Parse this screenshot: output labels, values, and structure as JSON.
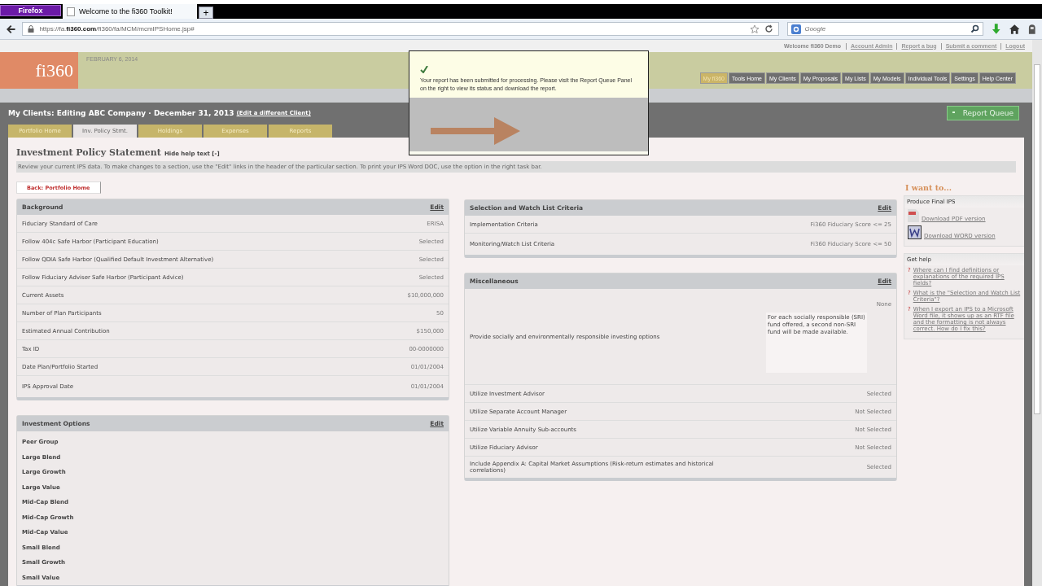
{
  "browser": {
    "firefox_button": "Firefox",
    "tab_title": "Welcome to the fi360 Toolkit!",
    "new_tab": "+",
    "url": "https://fa.**fi360.com**/fi360/fa/MCM/mcmIPSHome.jsp#",
    "search_placeholder": "Google"
  },
  "top_links": {
    "welcome": "Welcome fi360 Demo",
    "links": [
      "Account Admin",
      "Report a bug",
      "Submit a comment",
      "Logout"
    ]
  },
  "header": {
    "logo": "fi360",
    "date": "FEBRUARY 6, 2014",
    "menu": [
      {
        "label": "My fi360",
        "selected": true
      },
      {
        "label": "Tools Home",
        "selected": false
      },
      {
        "label": "My Clients",
        "selected": false
      },
      {
        "label": "My Proposals",
        "selected": false
      },
      {
        "label": "My Lists",
        "selected": false
      },
      {
        "label": "My Models",
        "selected": false
      },
      {
        "label": "Individual Tools",
        "selected": false
      },
      {
        "label": "Settings",
        "selected": false
      },
      {
        "label": "Help Center",
        "selected": false
      }
    ]
  },
  "client_bar": {
    "title": "My Clients: Editing ABC Company · December 31, 2013",
    "link": "(Edit a different Client)",
    "report_queue": "Report Queue"
  },
  "tabs": [
    {
      "label": "Portfolio Home",
      "selected": false
    },
    {
      "label": "Inv. Policy Stmt.",
      "selected": true
    },
    {
      "label": "Holdings",
      "selected": false
    },
    {
      "label": "Expenses",
      "selected": false
    },
    {
      "label": "Reports",
      "selected": false
    }
  ],
  "popup": {
    "message": "Your report has been submitted for processing. Please visit the Report Queue Panel on the right to view its status and download the report."
  },
  "page": {
    "title": "Investment Policy Statement",
    "help_toggle": "Hide help text [-]",
    "help_text": "Review your current IPS data. To make changes to a section, use the \"Edit\" links in the header of the particular section. To print your IPS Word DOC, use the option in the right task bar.",
    "back_button": "Back: Portfolio Home"
  },
  "sections_left": [
    {
      "title": "Background",
      "edit": "Edit",
      "kind": "table",
      "rows": [
        {
          "label": "Fiduciary Standard of Care",
          "value": "ERISA"
        },
        {
          "label": "Follow 404c Safe Harbor (Participant Education)",
          "value": "Selected"
        },
        {
          "label": "Follow QDIA Safe Harbor (Qualified Default Investment Alternative)",
          "value": "Selected"
        },
        {
          "label": "Follow Fiduciary Adviser Safe Harbor (Participant Advice)",
          "value": "Selected"
        },
        {
          "label": "Current Assets",
          "value": "$10,000,000"
        },
        {
          "label": "Number of Plan Participants",
          "value": "50"
        },
        {
          "label": "Estimated Annual Contribution",
          "value": "$150,000"
        },
        {
          "label": "Tax ID",
          "value": "00-0000000"
        },
        {
          "label": "Date Plan/Portfolio Started",
          "value": "01/01/2004"
        },
        {
          "label": "IPS Approval Date",
          "value": "01/01/2004"
        }
      ]
    },
    {
      "title": "Investment Options",
      "edit": "Edit",
      "kind": "list",
      "items": [
        "Peer Group",
        "Large Blend",
        "Large Growth",
        "Large Value",
        "Mid-Cap Blend",
        "Mid-Cap Growth",
        "Mid-Cap Value",
        "Small Blend",
        "Small Growth",
        "Small Value"
      ]
    }
  ],
  "sections_right": [
    {
      "title": "Selection and Watch List Criteria",
      "edit": "Edit",
      "kind": "table",
      "rows": [
        {
          "label": "Implementation Criteria",
          "value": "Fi360 Fiduciary Score <= 25"
        },
        {
          "label": "Monitoring/Watch List Criteria",
          "value": "Fi360 Fiduciary Score <= 50"
        }
      ]
    },
    {
      "title": "Miscellaneous",
      "edit": "Edit",
      "kind": "table",
      "rows": [
        {
          "label": "Provide socially and environmentally responsible investing options",
          "value": "None",
          "note": "For each socially responsible (SRI) fund offered, a second non-SRI fund will be made available."
        },
        {
          "label": "Utilize Investment Advisor",
          "value": "Selected"
        },
        {
          "label": "Utilize Separate Account Manager",
          "value": "Not Selected"
        },
        {
          "label": "Utilize Variable Annuity Sub-accounts",
          "value": "Not Selected"
        },
        {
          "label": "Utilize Fiduciary Advisor",
          "value": "Not Selected"
        },
        {
          "label": "Include Appendix A: Capital Market Assumptions (Risk-return estimates and historical correlations)",
          "value": "Selected"
        }
      ]
    }
  ],
  "sidebar": {
    "title": "I want to...",
    "boxes": [
      {
        "title": "Produce Final IPS",
        "kind": "downloads",
        "links": [
          {
            "label": "Download PDF version",
            "kind": "pdf"
          },
          {
            "label": "Download WORD version",
            "kind": "word"
          }
        ]
      },
      {
        "title": "Get help",
        "kind": "help",
        "links": [
          {
            "marker": "?",
            "label": "Where can I find definitions or explanations of the required IPS fields?"
          },
          {
            "marker": "?",
            "label": "What is the \"Selection and Watch List Criteria\"?"
          },
          {
            "marker": "?",
            "label": "When I export an IPS to a Microsoft Word file, it shows up as an RTF file and the formatting is not always correct. How do I fix this?"
          }
        ]
      }
    ]
  }
}
